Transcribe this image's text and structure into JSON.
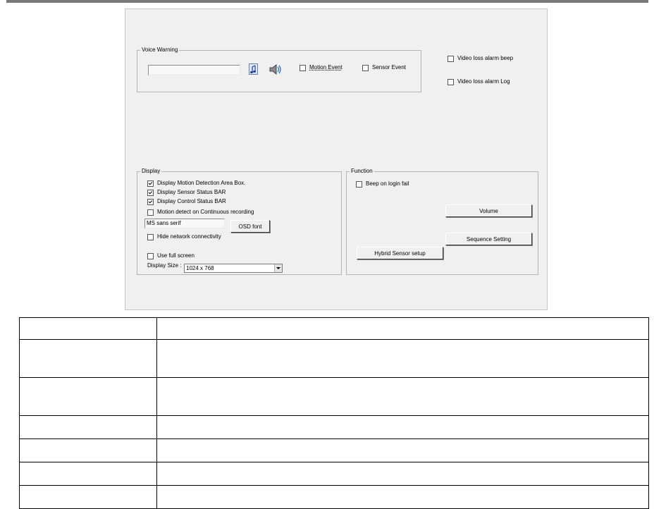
{
  "voice_warning": {
    "legend": "Voice Warning",
    "file_value": "",
    "motion_event": {
      "label": "Motion Event",
      "checked": false
    },
    "sensor_event": {
      "label": "Sensor Event",
      "checked": false
    },
    "icons": [
      "music-file-icon",
      "speaker-icon"
    ]
  },
  "video_loss": {
    "beep": {
      "label": "Video loss alarm beep",
      "checked": false
    },
    "log": {
      "label": "Video loss alarm Log",
      "checked": false
    }
  },
  "display": {
    "legend": "Display",
    "options": [
      {
        "label": "Display Motion Detection Area Box.",
        "checked": true
      },
      {
        "label": "Display Sensor Status BAR",
        "checked": true
      },
      {
        "label": "Display Control Status BAR",
        "checked": true
      },
      {
        "label": "Motion detect on Continuous recording",
        "checked": false
      }
    ],
    "font_value": "MS sans serif",
    "osd_font_button": "OSD font",
    "hide_network": {
      "label": "Hide network connectivity",
      "checked": false
    },
    "use_full_screen": {
      "label": "Use full screen",
      "checked": false
    },
    "display_size_label": "Display Size :",
    "display_size_value": "1024 x 768"
  },
  "function": {
    "legend": "Function",
    "beep_on_login_fail": {
      "label": "Beep on login fail",
      "checked": false
    },
    "volume_button": "Volume",
    "sequence_button": "Sequence Setting",
    "hybrid_button": "Hybrid Sensor setup"
  },
  "table": {
    "rows": [
      [
        "",
        ""
      ],
      [
        "",
        ""
      ],
      [
        "",
        ""
      ],
      [
        "",
        ""
      ],
      [
        "",
        ""
      ],
      [
        "",
        ""
      ],
      [
        "",
        ""
      ]
    ]
  }
}
